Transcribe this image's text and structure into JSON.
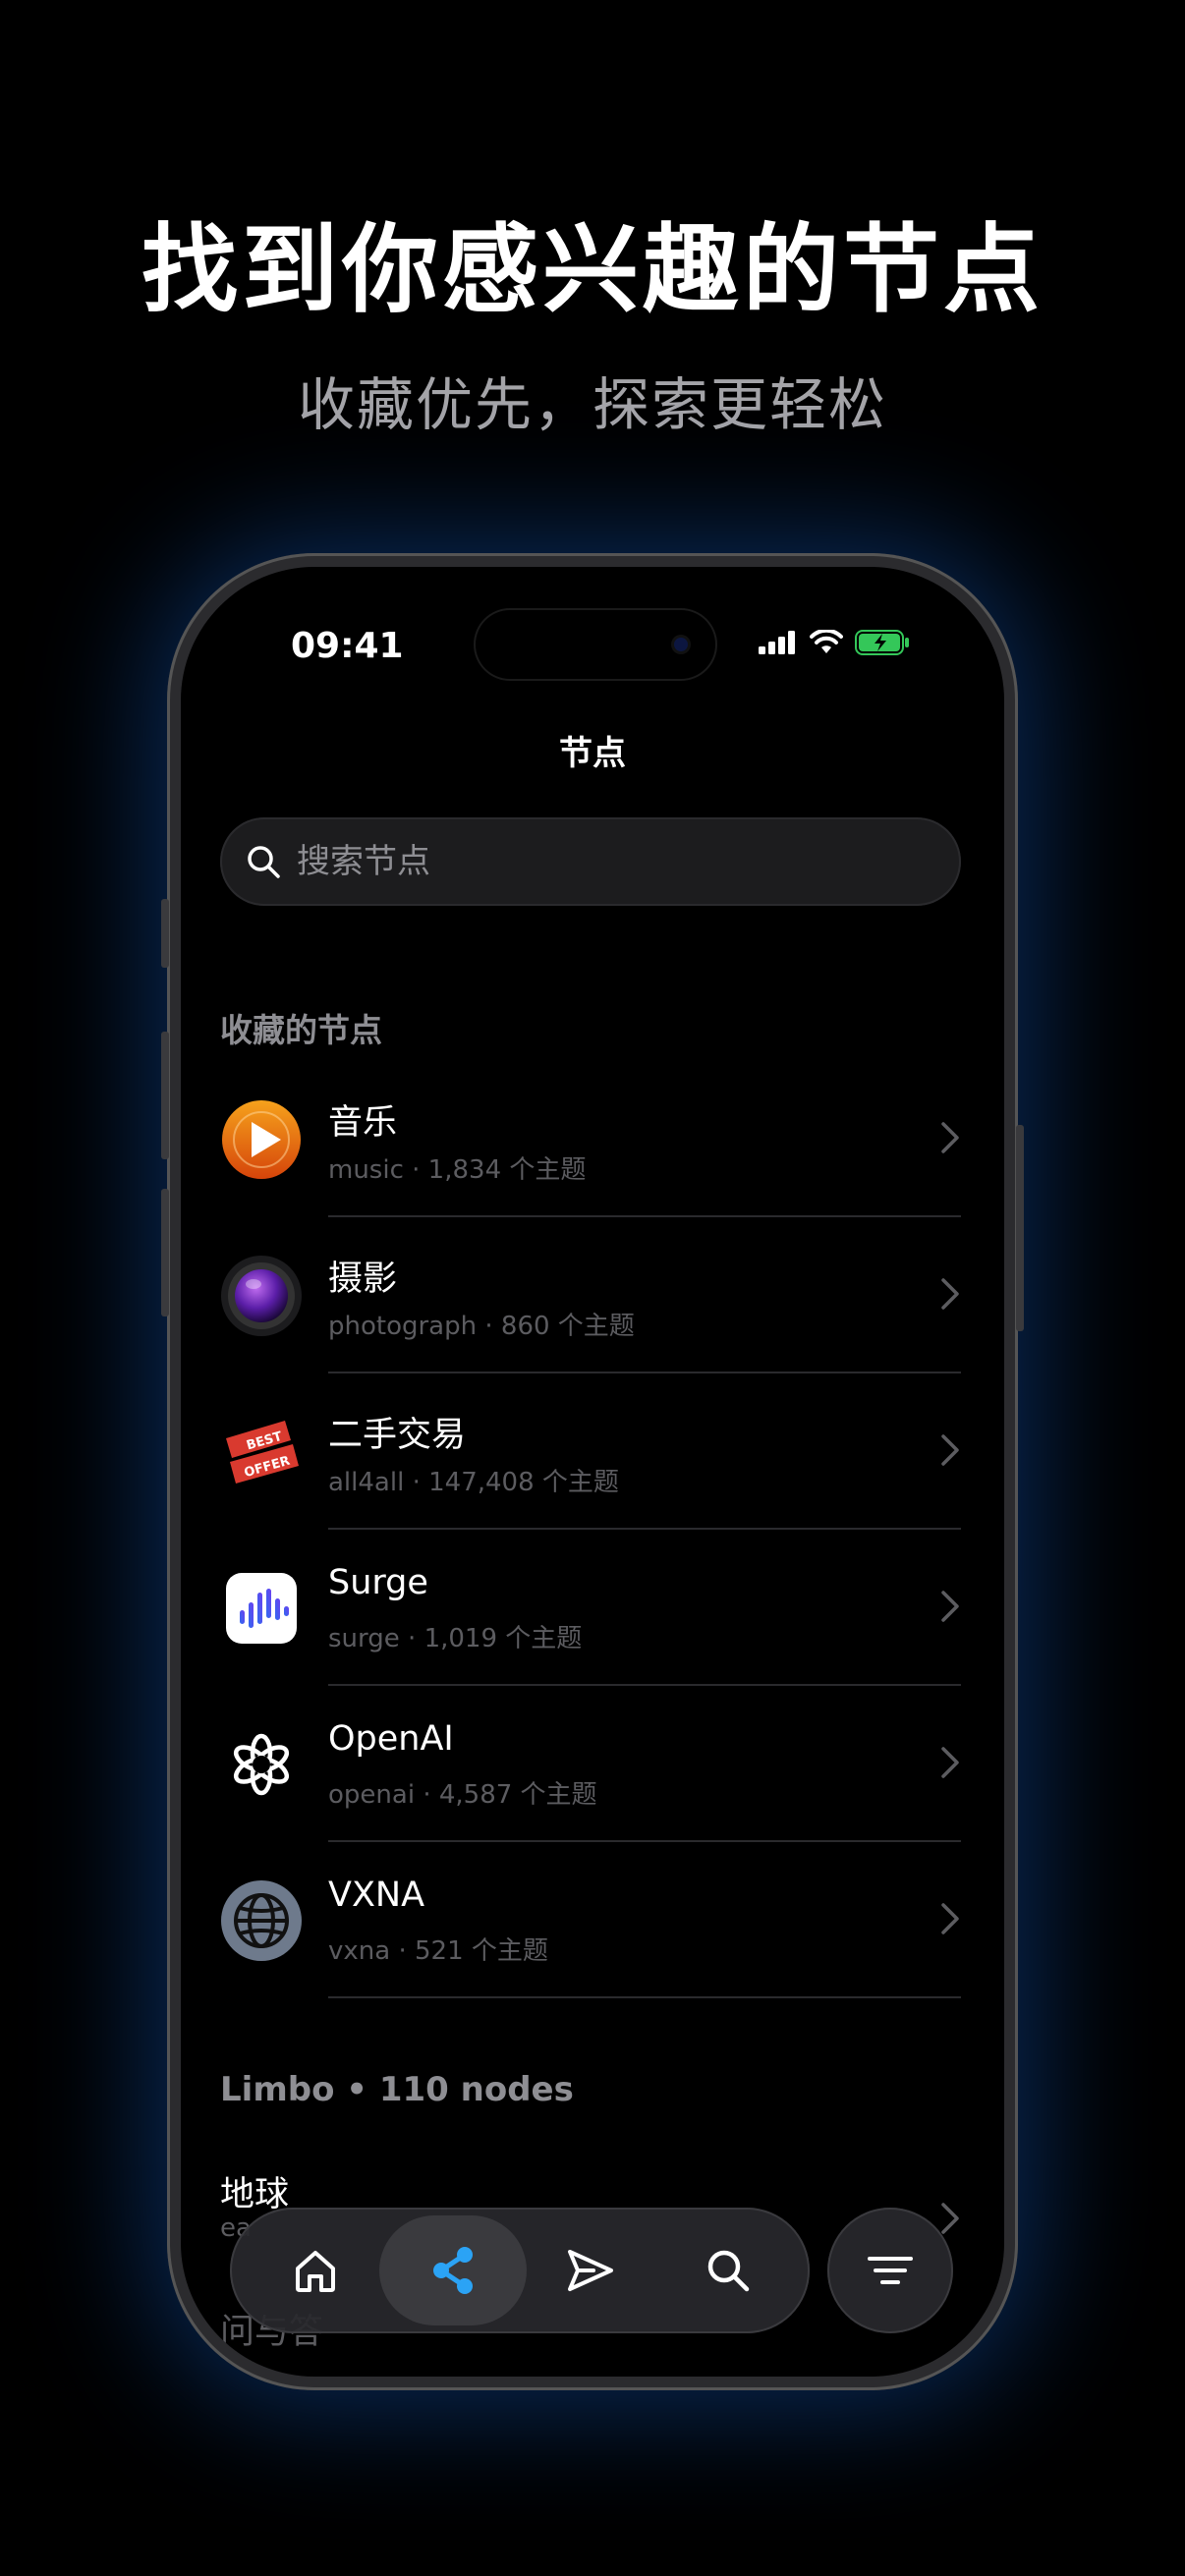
{
  "promo": {
    "headline": "找到你感兴趣的节点",
    "subheadline": "收藏优先，探索更轻松"
  },
  "status_bar": {
    "time": "09:41",
    "icons": [
      "cellular-signal-icon",
      "wifi-icon",
      "battery-charging-icon"
    ]
  },
  "nav": {
    "title": "节点"
  },
  "search": {
    "placeholder": "搜索节点",
    "value": ""
  },
  "favorites": {
    "section_label": "收藏的节点",
    "items": [
      {
        "title": "音乐",
        "slug": "music",
        "sep": "·",
        "count": "1,834 个主题",
        "icon": "music-play-icon"
      },
      {
        "title": "摄影",
        "slug": "photograph",
        "sep": "·",
        "count": "860 个主题",
        "icon": "camera-lens-icon"
      },
      {
        "title": "二手交易",
        "slug": "all4all",
        "sep": "·",
        "count": "147,408 个主题",
        "icon": "best-offer-badge-icon",
        "badge_top": "BEST",
        "badge_bottom": "OFFER"
      },
      {
        "title": "Surge",
        "slug": "surge",
        "sep": "·",
        "count": "1,019 个主题",
        "icon": "surge-logo-icon"
      },
      {
        "title": "OpenAI",
        "slug": "openai",
        "sep": "·",
        "count": "4,587 个主题",
        "icon": "openai-logo-icon"
      },
      {
        "title": "VXNA",
        "slug": "vxna",
        "sep": "·",
        "count": "521 个主题",
        "icon": "globe-icon"
      }
    ]
  },
  "limbo": {
    "section_label": "Limbo • 110 nodes",
    "items": [
      {
        "title": "地球",
        "slug": "ea"
      },
      {
        "title": "问与答"
      }
    ]
  },
  "tab_bar": {
    "tabs": [
      {
        "name": "home",
        "icon": "home-icon",
        "active": false
      },
      {
        "name": "nodes",
        "icon": "share-nodes-icon",
        "active": true
      },
      {
        "name": "send",
        "icon": "send-icon",
        "active": false
      },
      {
        "name": "search",
        "icon": "search-icon",
        "active": false
      }
    ],
    "filter_icon": "filter-lines-icon"
  },
  "colors": {
    "accent_blue": "#2ba3f5",
    "battery_green": "#34c759",
    "background": "#000000"
  }
}
